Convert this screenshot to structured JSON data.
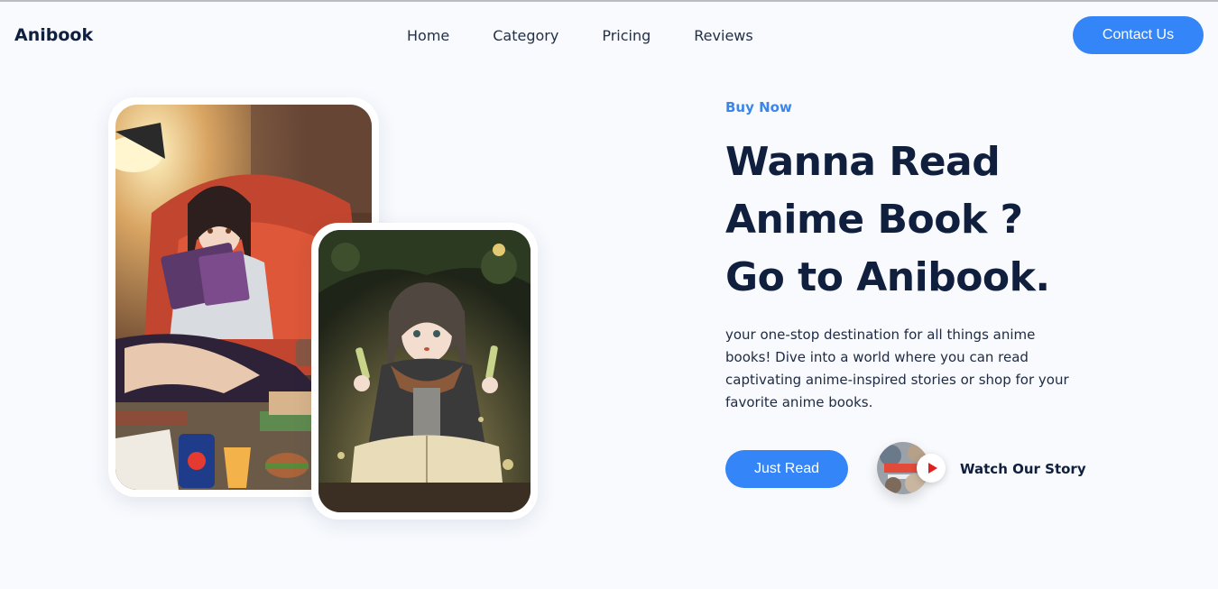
{
  "brand": {
    "name": "Anibook"
  },
  "nav": {
    "items": [
      {
        "label": "Home"
      },
      {
        "label": "Category"
      },
      {
        "label": "Pricing"
      },
      {
        "label": "Reviews"
      }
    ],
    "contact_label": "Contact Us"
  },
  "hero": {
    "eyebrow": "Buy Now",
    "headline_line1": "Wanna Read",
    "headline_line2": "Anime Book ?",
    "headline_line3": "Go to Anibook.",
    "description": "your one-stop destination for all things anime books! Dive into a world where you can read captivating anime-inspired stories or shop for your favorite anime books.",
    "read_button": "Just Read",
    "story_label": "Watch Our Story"
  },
  "colors": {
    "accent": "#3485f7",
    "heading": "#0f1f3d",
    "background": "#f8fafe",
    "play": "#e02020"
  },
  "icons": {
    "play": "play-icon"
  }
}
